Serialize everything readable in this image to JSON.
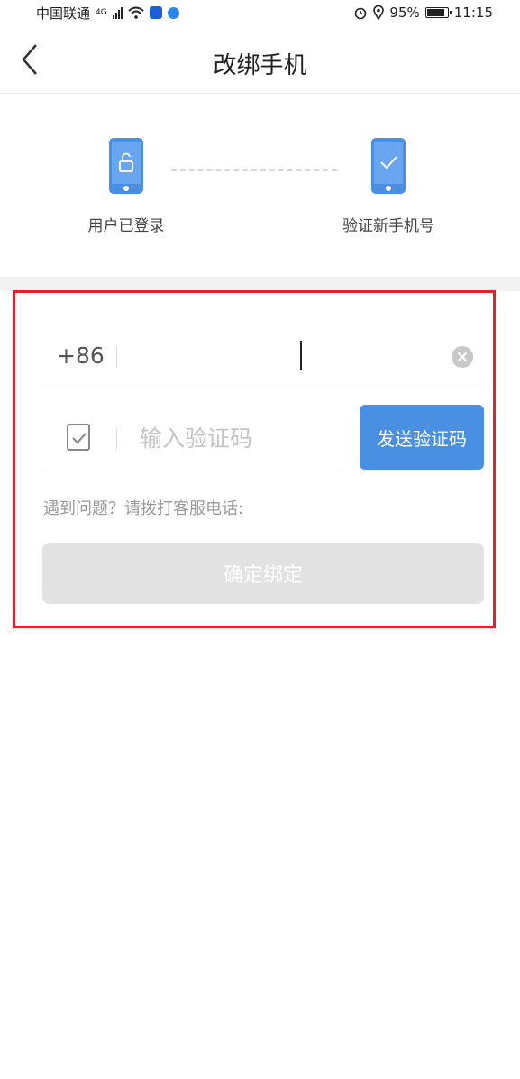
{
  "status_bar": {
    "carrier": "中国联通",
    "network": "4G",
    "battery": "95%",
    "battery_level": 0.95,
    "time": "11:15",
    "icons": [
      "signal-icon",
      "wifi-icon",
      "shield-app-icon",
      "dot-app-icon",
      "alarm-icon",
      "location-icon",
      "battery-icon"
    ]
  },
  "navbar": {
    "title": "改绑手机",
    "back_icon": "chevron-left-icon"
  },
  "steps": [
    {
      "label": "用户已登录",
      "icon": "phone-unlock-icon",
      "color": "#4a90e2"
    },
    {
      "label": "验证新手机号",
      "icon": "phone-check-icon",
      "color": "#4a90e2"
    }
  ],
  "form": {
    "country_code": "+86",
    "phone_value": "",
    "code_placeholder": "输入验证码",
    "send_code_label": "发送验证码",
    "help_text": "遇到问题？请拨打客服电话:",
    "confirm_label": "确定绑定"
  },
  "colors": {
    "accent": "#4a90e2",
    "disabled_button": "#e2e2e2",
    "highlight_border": "#d9262c"
  }
}
